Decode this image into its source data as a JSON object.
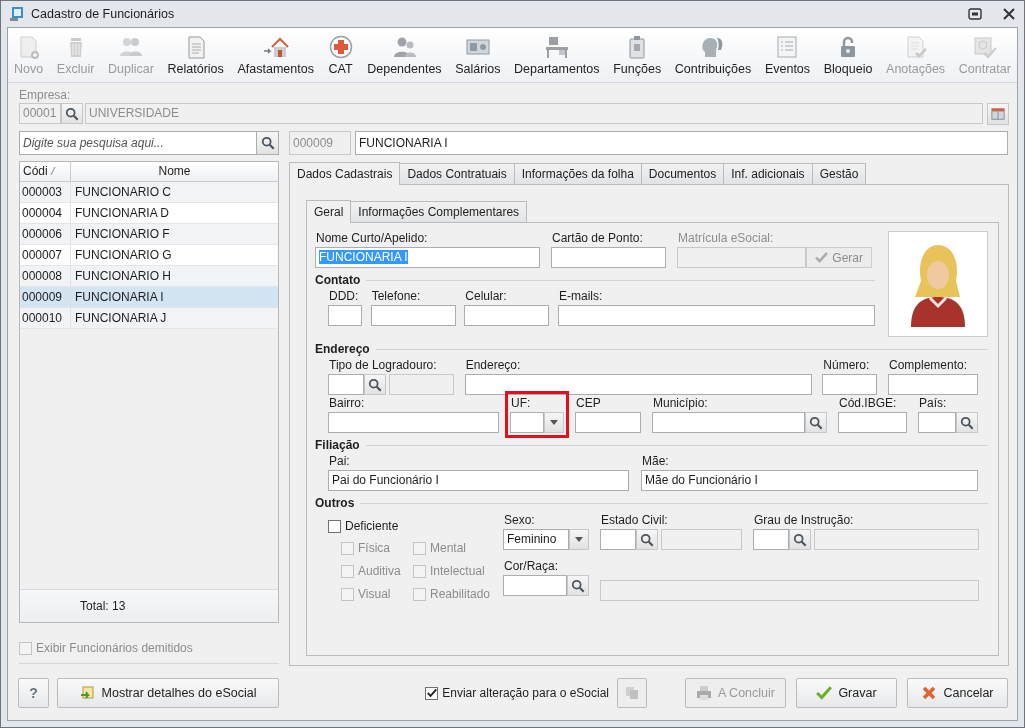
{
  "window": {
    "title": "Cadastro de Funcionários"
  },
  "toolbar": [
    {
      "label": "Novo",
      "disabled": true
    },
    {
      "label": "Excluir",
      "disabled": true
    },
    {
      "label": "Duplicar",
      "disabled": true
    },
    {
      "label": "Relatórios",
      "disabled": false
    },
    {
      "label": "Afastamentos",
      "disabled": false
    },
    {
      "label": "CAT",
      "disabled": false
    },
    {
      "label": "Dependentes",
      "disabled": false
    },
    {
      "label": "Salários",
      "disabled": false
    },
    {
      "label": "Departamentos",
      "disabled": false
    },
    {
      "label": "Funções",
      "disabled": false
    },
    {
      "label": "Contribuições",
      "disabled": false
    },
    {
      "label": "Eventos",
      "disabled": false
    },
    {
      "label": "Bloqueio",
      "disabled": false
    },
    {
      "label": "Anotações",
      "disabled": true
    },
    {
      "label": "Contratar",
      "disabled": true
    }
  ],
  "empresa": {
    "label": "Empresa:",
    "code": "00001",
    "name": "UNIVERSIDADE",
    "disabled": true
  },
  "search": {
    "placeholder": "Digite sua pesquisa aqui...",
    "code": "000009",
    "name": "FUNCIONARIA I"
  },
  "employee_list": {
    "columns": [
      "Códi",
      "Nome"
    ],
    "rows": [
      {
        "code": "000003",
        "name": "FUNCIONARIO C",
        "selected": false
      },
      {
        "code": "000004",
        "name": "FUNCIONARIA D",
        "selected": false
      },
      {
        "code": "000006",
        "name": "FUNCIONARIO F",
        "selected": false
      },
      {
        "code": "000007",
        "name": "FUNCIONARIO G",
        "selected": false
      },
      {
        "code": "000008",
        "name": "FUNCIONARIO H",
        "selected": false
      },
      {
        "code": "000009",
        "name": "FUNCIONARIA I",
        "selected": true
      },
      {
        "code": "000010",
        "name": "FUNCIONARIA J",
        "selected": false
      }
    ],
    "footer": "Total: 13"
  },
  "show_dismissed": {
    "label": "Exibir Funcionários demitidos",
    "checked": false,
    "disabled": true
  },
  "tabs": [
    {
      "label": "Dados Cadastrais",
      "selected": true
    },
    {
      "label": "Dados Contratuais",
      "selected": false
    },
    {
      "label": "Informações da folha",
      "selected": false
    },
    {
      "label": "Documentos",
      "selected": false
    },
    {
      "label": "Inf. adicionais",
      "selected": false
    },
    {
      "label": "Gestão",
      "selected": false
    }
  ],
  "subtabs": [
    {
      "label": "Geral",
      "selected": true
    },
    {
      "label": "Informações Complementares",
      "selected": false
    }
  ],
  "top_fields": [
    {
      "label": "Nome Curto/Apelido:",
      "value": "FUNCIONARIA I",
      "text_selected": true,
      "disabled": false
    },
    {
      "label": "Cartão de Ponto:",
      "disabled": false
    },
    {
      "label": "Matrícula eSocial:",
      "disabled": true
    }
  ],
  "gerar_button": {
    "label": "Gerar",
    "disabled": true
  },
  "sections": [
    {
      "title": "Contato",
      "fields": [
        {
          "label": "DDD:",
          "kind": "text"
        },
        {
          "label": "Telefone:",
          "kind": "text"
        },
        {
          "label": "Celular:",
          "kind": "text"
        },
        {
          "label": "E-mails:",
          "kind": "text"
        }
      ]
    },
    {
      "title": "Endereço",
      "fields": [
        {
          "label": "Tipo de Logradouro:",
          "kind": "lookup_pair"
        },
        {
          "label": "Endereço:",
          "kind": "text"
        },
        {
          "label": "Número:",
          "kind": "text"
        },
        {
          "label": "Complemento:",
          "kind": "text"
        },
        {
          "label": "Bairro:",
          "kind": "text"
        },
        {
          "label": "UF:",
          "kind": "combo",
          "highlighted": true
        },
        {
          "label": "CEP",
          "kind": "text"
        },
        {
          "label": "Município:",
          "kind": "lookup"
        },
        {
          "label": "Cód.IBGE:",
          "kind": "text"
        },
        {
          "label": "País:",
          "kind": "lookup"
        }
      ]
    },
    {
      "title": "Filiação",
      "fields": [
        {
          "label": "Pai:",
          "kind": "text",
          "value": "Pai do Funcionário I"
        },
        {
          "label": "Mãe:",
          "kind": "text",
          "value": "Mãe do Funcionário I"
        }
      ]
    }
  ],
  "outros": {
    "title": "Outros",
    "deficiente": {
      "label": "Deficiente",
      "checked": false
    },
    "deficiencias": [
      {
        "label": "Física",
        "checked": false,
        "disabled": true
      },
      {
        "label": "Mental",
        "checked": false,
        "disabled": true
      },
      {
        "label": "Auditiva",
        "checked": false,
        "disabled": true
      },
      {
        "label": "Intelectual",
        "checked": false,
        "disabled": true
      },
      {
        "label": "Visual",
        "checked": false,
        "disabled": true
      },
      {
        "label": "Reabilitado",
        "checked": false,
        "disabled": true
      }
    ],
    "fields": [
      {
        "label": "Sexo:",
        "kind": "combo",
        "value": "Feminino"
      },
      {
        "label": "Estado Civil:",
        "kind": "lookup_pair"
      },
      {
        "label": "Grau de Instrução:",
        "kind": "lookup_pair"
      },
      {
        "label": "Cor/Raça:",
        "kind": "lookup"
      },
      {
        "kind": "description"
      }
    ]
  },
  "footer": {
    "help": "?",
    "esocial_details": "Mostrar detalhes do eSocial",
    "send": {
      "label": "Enviar alteração para o eSocial",
      "checked": true
    },
    "buttons": [
      {
        "label": "A Concluir",
        "kind": "conclude",
        "disabled": true
      },
      {
        "label": "Gravar",
        "kind": "save",
        "disabled": false
      },
      {
        "label": "Cancelar",
        "kind": "cancel",
        "disabled": false
      }
    ]
  }
}
